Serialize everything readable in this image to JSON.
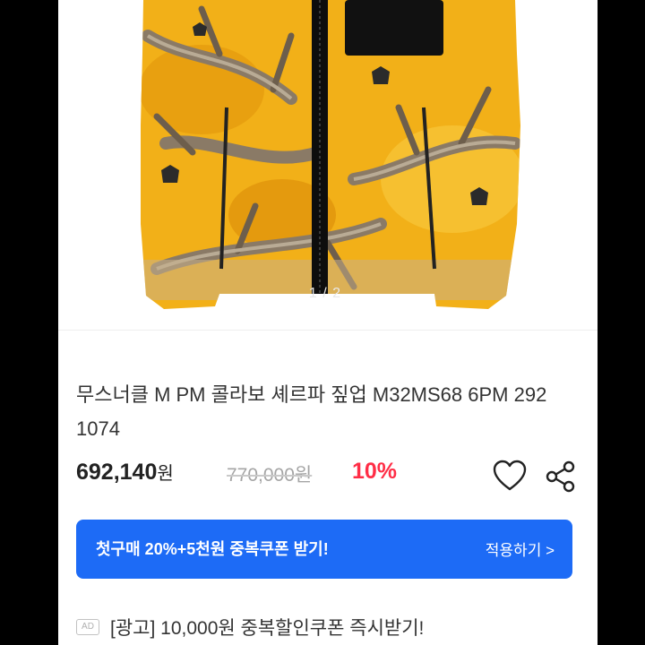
{
  "product": {
    "image_pager": "1 / 2",
    "title": "무스너클 M PM 콜라보 셰르파 짚업 M32MS68 6PM 292 1074",
    "price": "692,140",
    "price_unit": "원",
    "original_price": "770,000원",
    "discount": "10%"
  },
  "coupon": {
    "text": "첫구매 20%+5천원 중복쿠폰 받기!",
    "apply_label": "적용하기 >"
  },
  "ad": {
    "badge": "AD",
    "text": "[광고] 10,000원 중복할인쿠폰 즉시받기!"
  },
  "colors": {
    "accent_blue": "#1d6bf6",
    "discount_red": "#ff2d46",
    "jacket_yellow": "#f2b018"
  },
  "icons": [
    "heart-icon",
    "share-icon"
  ]
}
